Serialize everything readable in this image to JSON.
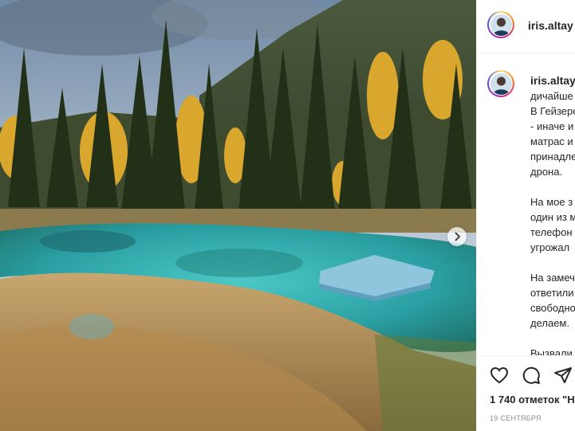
{
  "post": {
    "username": "iris.altay",
    "caption_lines": [
      "дичайше",
      "В Гейзеро",
      "- иначе и",
      "матрас и",
      "принадле",
      "дрона.",
      "",
      "На мое з",
      "один из м",
      "телефон",
      "угрожал",
      "",
      "На замеч",
      "ответили",
      "свободно",
      "делаем.",
      "",
      "Вызвали"
    ],
    "likes_text": "1 740 отметок \"Н",
    "date": "19 СЕНТЯБРЯ"
  },
  "icons": {
    "like": "heart-icon",
    "comment": "comment-icon",
    "share": "share-icon",
    "next": "chevron-right-icon"
  },
  "colors": {
    "text": "#262626",
    "muted": "#8e8e8e",
    "border": "#efefef",
    "water": "#2fb3b3"
  }
}
